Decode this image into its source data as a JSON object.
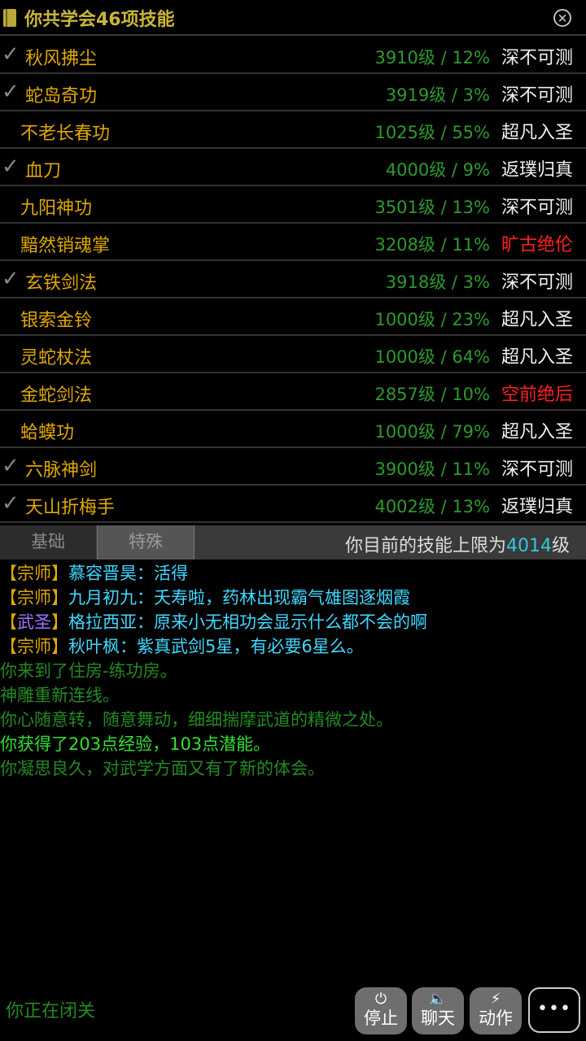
{
  "header": {
    "title": "你共学会46项技能"
  },
  "skills": [
    {
      "name": "秋风拂尘",
      "level": "3910级 / 12%",
      "rank": "深不可测",
      "learned": true,
      "rank_red": false
    },
    {
      "name": "蛇岛奇功",
      "level": "3919级 / 3%",
      "rank": "深不可测",
      "learned": true,
      "rank_red": false
    },
    {
      "name": "不老长春功",
      "level": "1025级 / 55%",
      "rank": "超凡入圣",
      "learned": false,
      "rank_red": false
    },
    {
      "name": "血刀",
      "level": "4000级 / 9%",
      "rank": "返璞归真",
      "learned": true,
      "rank_red": false
    },
    {
      "name": "九阳神功",
      "level": "3501级 / 13%",
      "rank": "深不可测",
      "learned": false,
      "rank_red": false
    },
    {
      "name": "黯然销魂掌",
      "level": "3208级 / 11%",
      "rank": "旷古绝伦",
      "learned": false,
      "rank_red": true
    },
    {
      "name": "玄铁剑法",
      "level": "3918级 / 3%",
      "rank": "深不可测",
      "learned": true,
      "rank_red": false
    },
    {
      "name": "银索金铃",
      "level": "1000级 / 23%",
      "rank": "超凡入圣",
      "learned": false,
      "rank_red": false
    },
    {
      "name": "灵蛇杖法",
      "level": "1000级 / 64%",
      "rank": "超凡入圣",
      "learned": false,
      "rank_red": false
    },
    {
      "name": "金蛇剑法",
      "level": "2857级 / 10%",
      "rank": "空前绝后",
      "learned": false,
      "rank_red": true
    },
    {
      "name": "蛤蟆功",
      "level": "1000级 / 79%",
      "rank": "超凡入圣",
      "learned": false,
      "rank_red": false
    },
    {
      "name": "六脉神剑",
      "level": "3900级 / 11%",
      "rank": "深不可测",
      "learned": true,
      "rank_red": false
    },
    {
      "name": "天山折梅手",
      "level": "4002级 / 13%",
      "rank": "返璞归真",
      "learned": true,
      "rank_red": false
    }
  ],
  "tabs": {
    "basic": "基础",
    "special": "特殊"
  },
  "limit": {
    "prefix": "你目前的技能上限为",
    "value": "4014",
    "suffix": "级"
  },
  "chat": [
    {
      "title": "宗师",
      "title_color": "gold",
      "text": "慕容晋昊：活得"
    },
    {
      "title": "宗师",
      "title_color": "gold",
      "text": "九月初九：夭寿啦，药林出现霸气雄图逐烟霞"
    },
    {
      "title": "武圣",
      "title_color": "purple",
      "text": "格拉西亚：原来小无相功会显示什么都不会的啊"
    },
    {
      "title": "宗师",
      "title_color": "gold",
      "text": "秋叶枫：紫真武剑5星，有必要6星么。"
    }
  ],
  "system": [
    {
      "text": "你来到了住房-练功房。",
      "bright": false
    },
    {
      "text": "神雕重新连线。",
      "bright": false
    },
    {
      "text": "你心随意转，随意舞动，细细揣摩武道的精微之处。",
      "bright": false
    },
    {
      "text": "你获得了203点经验，103点潜能。",
      "bright": true
    },
    {
      "text": "你凝思良久，对武学方面又有了新的体会。",
      "bright": false
    }
  ],
  "status": "你正在闭关",
  "buttons": {
    "stop": "停止",
    "chat": "聊天",
    "action": "动作",
    "more": "•••"
  },
  "colors": {
    "skill_name": "#e0a800",
    "level": "#2e9a2e",
    "rank_red": "#ff2020",
    "accent_cyan": "#30c8e0"
  },
  "icons": {
    "header": "book-icon",
    "close": "close-icon",
    "check": "check-icon",
    "stop": "power-icon",
    "chat": "speaker-icon",
    "action": "bolt-icon"
  }
}
